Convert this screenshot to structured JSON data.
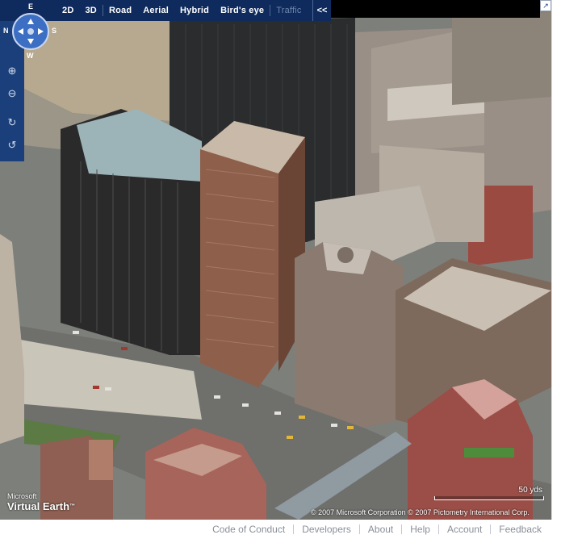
{
  "toolbar": {
    "items": [
      {
        "label": "2D",
        "state": "selected"
      },
      {
        "label": "3D",
        "state": "normal"
      },
      {
        "label": "Road",
        "state": "normal"
      },
      {
        "label": "Aerial",
        "state": "normal"
      },
      {
        "label": "Hybrid",
        "state": "normal"
      },
      {
        "label": "Bird's eye",
        "state": "selected"
      },
      {
        "label": "Traffic",
        "state": "disabled"
      }
    ],
    "collapse_label": "<<"
  },
  "navigation": {
    "compass": {
      "north": "E",
      "west": "N",
      "east": "S",
      "south": "W"
    },
    "buttons": [
      "zoom-in-icon",
      "zoom-out-icon",
      "rotate-clockwise-icon",
      "rotate-counterclockwise-icon"
    ]
  },
  "corner_icon": "expand-arrow-icon",
  "map": {
    "logo_line1": "Microsoft",
    "logo_line2": "Virtual Earth",
    "logo_tm": "™",
    "scale_label": "50 yds",
    "copyright": "© 2007 Microsoft Corporation   © 2007 Pictometry International Corp."
  },
  "footer": {
    "links": [
      "Code of Conduct",
      "Developers",
      "About",
      "Help",
      "Account",
      "Feedback"
    ]
  },
  "colors": {
    "toolbar_bg": "#0f2a5c",
    "nav_bg": "#123a7a",
    "footer_link": "#8a8f98"
  }
}
